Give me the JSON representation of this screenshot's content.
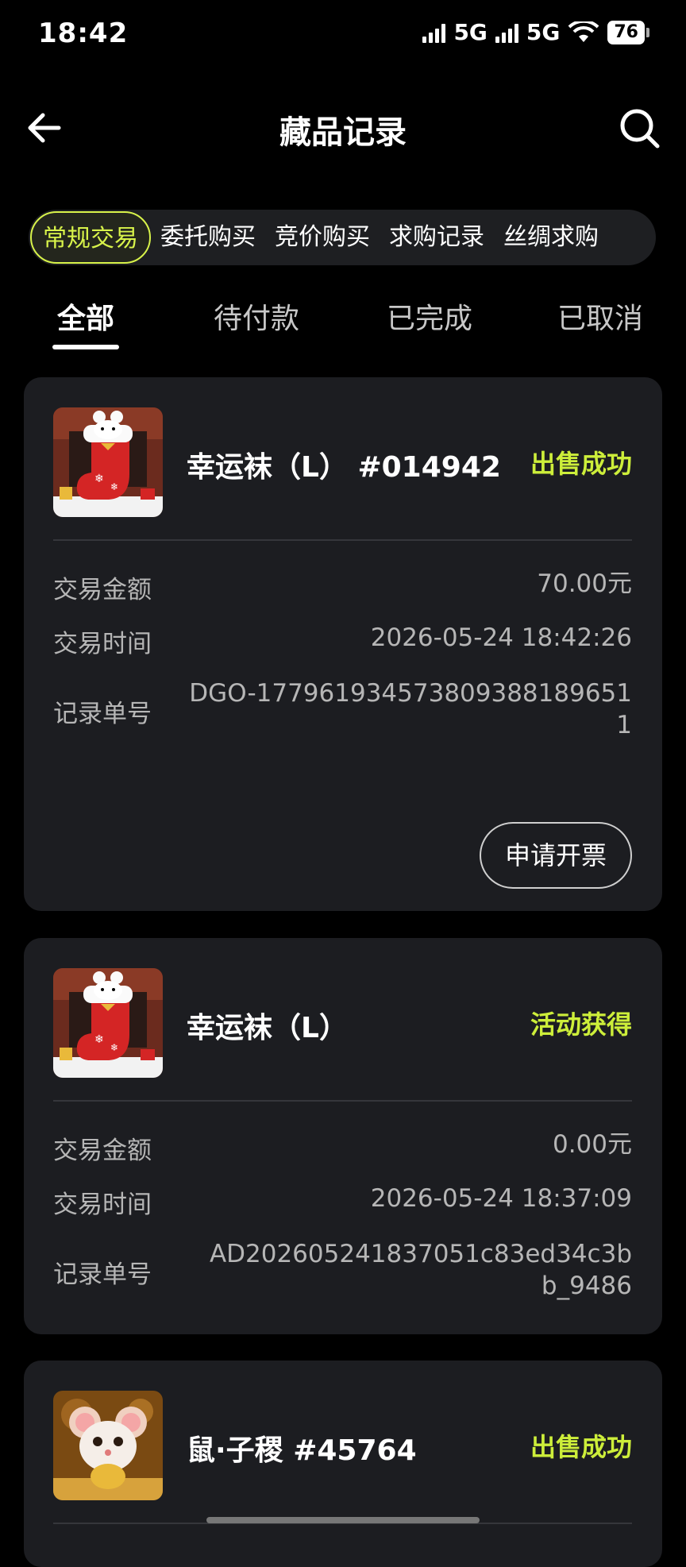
{
  "status_bar": {
    "time": "18:42",
    "network1": "5G",
    "network2": "5G",
    "battery": "76"
  },
  "header": {
    "title": "藏品记录",
    "back_icon": "arrow-left-icon",
    "search_icon": "search-icon"
  },
  "pills": [
    {
      "label": "常规交易",
      "active": true
    },
    {
      "label": "委托购买",
      "active": false
    },
    {
      "label": "竞价购买",
      "active": false
    },
    {
      "label": "求购记录",
      "active": false
    },
    {
      "label": "丝绸求购",
      "active": false
    }
  ],
  "tabs": [
    {
      "label": "全部",
      "active": true
    },
    {
      "label": "待付款",
      "active": false
    },
    {
      "label": "已完成",
      "active": false
    },
    {
      "label": "已取消",
      "active": false
    }
  ],
  "labels": {
    "amount": "交易金额",
    "time": "交易时间",
    "record_no": "记录单号",
    "invoice_button": "申请开票"
  },
  "records": [
    {
      "name": "幸运袜（L） #014942",
      "status": "出售成功",
      "amount": "70.00元",
      "time": "2026-05-24 18:42:26",
      "record_no_line1": "DGO-177961934573809388189651",
      "record_no_line2": "1",
      "thumbnail": "christmas-stocking-image"
    },
    {
      "name": "幸运袜（L）",
      "status": "活动获得",
      "amount": "0.00元",
      "time": "2026-05-24 18:37:09",
      "record_no_line1": "AD202605241837051c83ed34c3b",
      "record_no_line2": "b_9486",
      "thumbnail": "christmas-stocking-image"
    },
    {
      "name": "鼠·子稷 #45764",
      "status": "出售成功",
      "thumbnail": "golden-mouse-image"
    }
  ],
  "colors": {
    "accent": "#cdee3a",
    "card_bg": "#1c1d21",
    "page_bg": "#000000"
  }
}
